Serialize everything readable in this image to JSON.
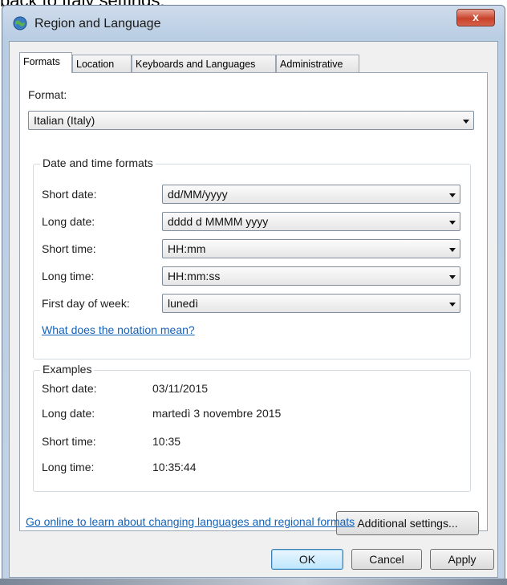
{
  "caption": "back to Italy settings.",
  "window": {
    "title": "Region and Language",
    "close_glyph": "x"
  },
  "tabs": [
    "Formats",
    "Location",
    "Keyboards and Languages",
    "Administrative"
  ],
  "format": {
    "label": "Format:",
    "value": "Italian (Italy)"
  },
  "date_time": {
    "group_title": "Date and time formats",
    "rows": [
      {
        "label": "Short date:",
        "value": "dd/MM/yyyy"
      },
      {
        "label": "Long date:",
        "value": "dddd d MMMM yyyy"
      },
      {
        "label": "Short time:",
        "value": "HH:mm"
      },
      {
        "label": "Long time:",
        "value": "HH:mm:ss"
      },
      {
        "label": "First day of week:",
        "value": "lunedì"
      }
    ],
    "notation_link": "What does the notation mean?"
  },
  "examples": {
    "group_title": "Examples",
    "rows": [
      {
        "label": "Short date:",
        "value": "03/11/2015"
      },
      {
        "label": "Long date:",
        "value": "martedì 3 novembre 2015"
      },
      {
        "label": "Short time:",
        "value": "10:35"
      },
      {
        "label": "Long time:",
        "value": "10:35:44"
      }
    ]
  },
  "additional_settings_label": "Additional settings...",
  "online_link": "Go online to learn about changing languages and regional formats",
  "buttons": {
    "ok": "OK",
    "cancel": "Cancel",
    "apply": "Apply"
  },
  "colors": {
    "link": "#1462b8",
    "close_button": "#c8432b",
    "default_button": "#bee6fd"
  }
}
